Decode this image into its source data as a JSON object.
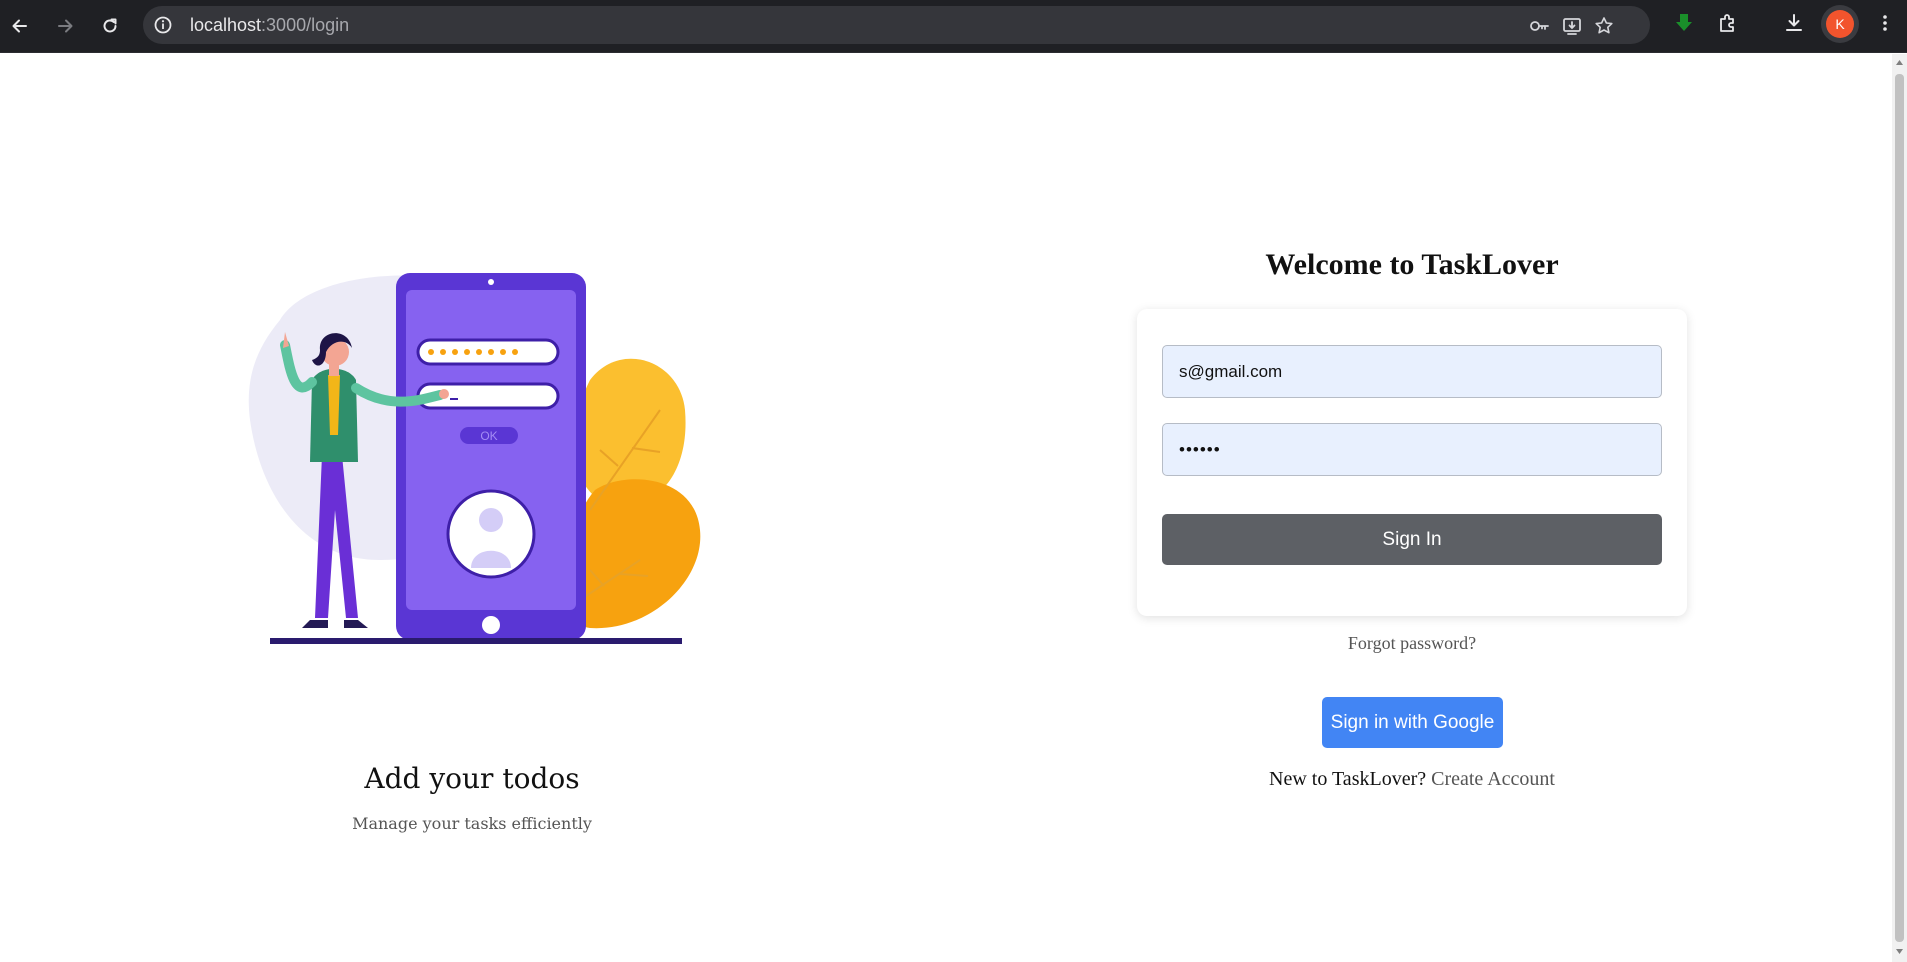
{
  "browser": {
    "url_host": "localhost",
    "url_path": ":3000/login",
    "profile_initial": "K"
  },
  "illustration": {
    "ok_label": "OK"
  },
  "hero": {
    "title": "Add your todos",
    "subtitle": "Manage your tasks efficiently"
  },
  "login": {
    "heading": "Welcome to TaskLover",
    "email_value": "s@gmail.com",
    "password_value": "••••••",
    "signin_label": "Sign In",
    "forgot_label": "Forgot password?",
    "google_label": "Sign in with Google",
    "signup_prompt": "New to TaskLover?",
    "signup_link": "Create Account"
  },
  "colors": {
    "google_blue": "#4285f4",
    "signin_gray": "#5d6065",
    "input_bg": "#e8f0fe",
    "phone_purple": "#5a36d4"
  }
}
